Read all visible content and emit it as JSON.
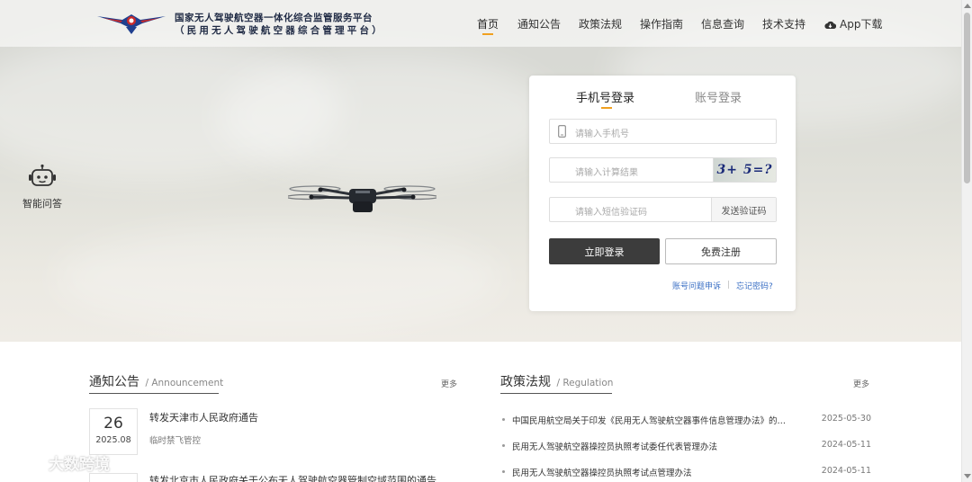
{
  "header": {
    "logo_line1": "国家无人驾驶航空器一体化综合监管服务平台",
    "logo_line2": "（民用无人驾驶航空器综合管理平台）",
    "nav": [
      {
        "label": "首页",
        "active": true
      },
      {
        "label": "通知公告"
      },
      {
        "label": "政策法规"
      },
      {
        "label": "操作指南"
      },
      {
        "label": "信息查询"
      },
      {
        "label": "技术支持"
      }
    ],
    "app_download": "App下载"
  },
  "side": {
    "ai_label": "智能问答"
  },
  "login": {
    "tab_phone": "手机号登录",
    "tab_account": "账号登录",
    "phone_placeholder": "请输入手机号",
    "calc_placeholder": "请输入计算结果",
    "captcha_text": "3+ 5=?",
    "sms_placeholder": "请输入短信验证码",
    "sms_button": "发送验证码",
    "login_button": "立即登录",
    "register_button": "免费注册",
    "appeal_link": "账号问题申诉",
    "forgot_link": "忘记密码?"
  },
  "notices": {
    "title": "通知公告",
    "title_en": "/ Announcement",
    "more": "更多",
    "items": [
      {
        "day": "26",
        "ym": "2025.08",
        "title": "转发天津市人民政府通告",
        "sub": "临时禁飞管控"
      },
      {
        "title": "转发北京市人民政府关于公布无人驾驶航空器管制空域范围的通告"
      }
    ]
  },
  "regulations": {
    "title": "政策法规",
    "title_en": "/ Regulation",
    "more": "更多",
    "items": [
      {
        "title": "中国民用航空局关于印发《民用无人驾驶航空器事件信息管理办法》的通知",
        "date": "2025-05-30"
      },
      {
        "title": "民用无人驾驶航空器操控员执照考试委任代表管理办法",
        "date": "2024-05-11"
      },
      {
        "title": "民用无人驾驶航空器操控员执照考试点管理办法",
        "date": "2024-05-11"
      }
    ]
  },
  "watermark": "大数跨境",
  "colors": {
    "accent": "#f0a020",
    "login_button": "#3c3c3c",
    "link": "#3a6fc4"
  }
}
